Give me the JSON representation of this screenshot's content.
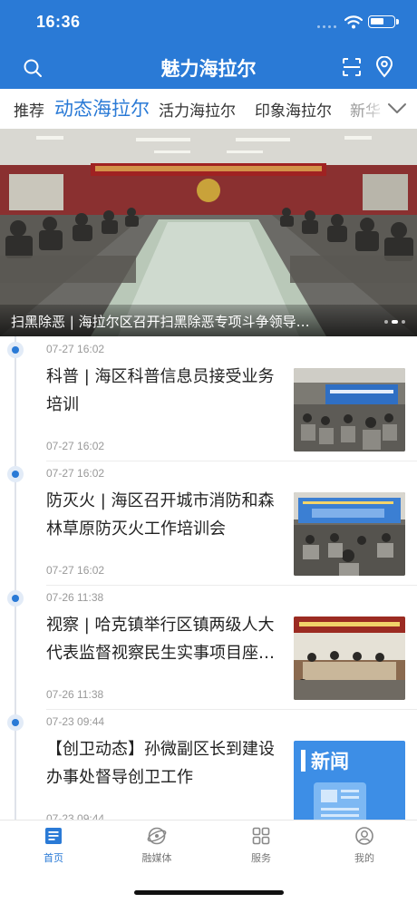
{
  "status_bar": {
    "time": "16:36"
  },
  "header": {
    "title": "魅力海拉尔"
  },
  "tabs": [
    {
      "label": "推荐",
      "active": false
    },
    {
      "label": "动态海拉尔",
      "active": true
    },
    {
      "label": "活力海拉尔",
      "active": false
    },
    {
      "label": "印象海拉尔",
      "active": false
    },
    {
      "label": "新华",
      "active": false
    }
  ],
  "banner": {
    "caption": "扫黑除恶 | 海拉尔区召开扫黑除恶专项斗争领导小组会议",
    "slide_count": 3,
    "active_slide": 2
  },
  "news": [
    {
      "time_top": "07-27 16:02",
      "title": "科普 | 海区科普信息员接受业务培训",
      "time_bottom": "07-27 16:02",
      "thumb": "meeting-training-photo"
    },
    {
      "time_top": "07-27 16:02",
      "title": "防灭火 | 海区召开城市消防和森林草原防灭火工作培训会",
      "time_bottom": "07-27 16:02",
      "thumb": "fire-prevention-meeting-photo"
    },
    {
      "time_top": "07-26 11:38",
      "title": "视察 | 哈克镇举行区镇两级人大代表监督视察民生实事项目座谈会",
      "time_bottom": "07-26 11:38",
      "thumb": "inspection-meeting-photo"
    },
    {
      "time_top": "07-23 09:44",
      "title": "【创卫动态】孙微副区长到建设办事处督导创卫工作",
      "time_bottom": "07-23 09:44",
      "thumb": "news-placeholder",
      "thumb_text": "新闻"
    }
  ],
  "bottom_nav": [
    {
      "label": "首页",
      "icon": "home-icon",
      "active": true
    },
    {
      "label": "融媒体",
      "icon": "media-globe-icon",
      "active": false
    },
    {
      "label": "服务",
      "icon": "grid-services-icon",
      "active": false
    },
    {
      "label": "我的",
      "icon": "profile-icon",
      "active": false
    }
  ],
  "colors": {
    "brand": "#2a7ad6",
    "text": "#222222",
    "muted": "#999999"
  }
}
